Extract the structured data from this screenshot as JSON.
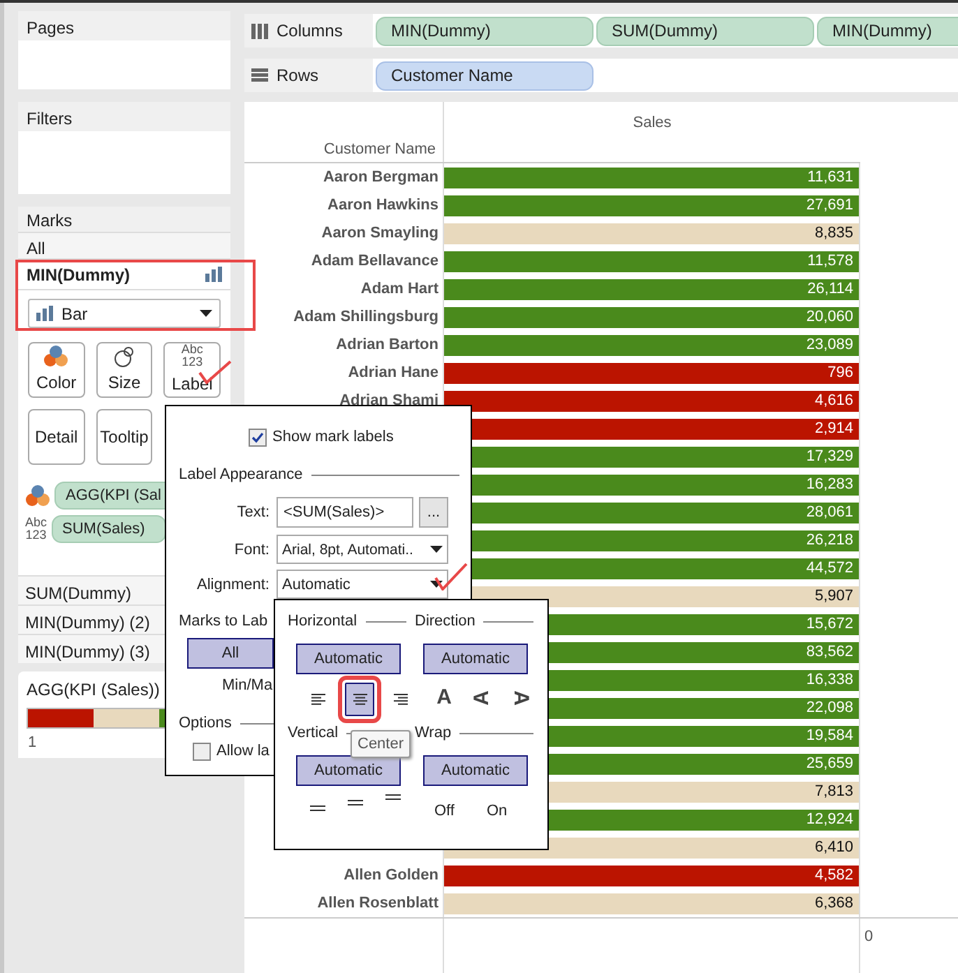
{
  "cards": {
    "pages": "Pages",
    "filters": "Filters"
  },
  "shelves": {
    "columns": {
      "label": "Columns",
      "pills": [
        "MIN(Dummy)",
        "SUM(Dummy)",
        "MIN(Dummy)"
      ]
    },
    "rows": {
      "label": "Rows",
      "pills": [
        "Customer Name"
      ]
    }
  },
  "marks": {
    "title": "Marks",
    "all": "All",
    "selected_layer": "MIN(Dummy)",
    "mark_type": "Bar",
    "buttons": [
      {
        "label": "Color",
        "kind": "color"
      },
      {
        "label": "Size",
        "kind": "size"
      },
      {
        "label": "Label",
        "kind": "label",
        "icon_text": [
          "Abc",
          "123"
        ]
      },
      {
        "label": "Detail",
        "kind": "detail"
      },
      {
        "label": "Tooltip",
        "kind": "tooltip"
      }
    ],
    "fields": [
      {
        "label": "AGG(KPI (Sal",
        "kind": "color"
      },
      {
        "label": "SUM(Sales)",
        "kind": "label",
        "icon_text": [
          "Abc",
          "123"
        ]
      }
    ],
    "layers": [
      "SUM(Dummy)",
      "MIN(Dummy) (2)",
      "MIN(Dummy) (3)"
    ]
  },
  "legend": {
    "title": "AGG(KPI (Sales))",
    "segments": [
      {
        "color": "#bb1400"
      },
      {
        "color": "#e8d9bd"
      },
      {
        "color": "#4a8a1c"
      }
    ],
    "tick": "1"
  },
  "chart": {
    "header": "Sales",
    "row_header": "Customer Name",
    "axis_tick": "0",
    "rows": [
      {
        "name": "Aaron Bergman",
        "value": "11,631",
        "color": "#4a8a1c"
      },
      {
        "name": "Aaron Hawkins",
        "value": "27,691",
        "color": "#4a8a1c"
      },
      {
        "name": "Aaron Smayling",
        "value": "8,835",
        "color": "#e8d9bd"
      },
      {
        "name": "Adam Bellavance",
        "value": "11,578",
        "color": "#4a8a1c"
      },
      {
        "name": "Adam Hart",
        "value": "26,114",
        "color": "#4a8a1c"
      },
      {
        "name": "Adam Shillingsburg",
        "value": "20,060",
        "color": "#4a8a1c"
      },
      {
        "name": "Adrian Barton",
        "value": "23,089",
        "color": "#4a8a1c"
      },
      {
        "name": "Adrian Hane",
        "value": "796",
        "color": "#bb1400"
      },
      {
        "name": "Adrian Shami",
        "value": "4,616",
        "color": "#bb1400"
      },
      {
        "value": "2,914",
        "color": "#bb1400"
      },
      {
        "value": "17,329",
        "color": "#4a8a1c"
      },
      {
        "value": "16,283",
        "color": "#4a8a1c"
      },
      {
        "value": "28,061",
        "color": "#4a8a1c"
      },
      {
        "value": "26,218",
        "color": "#4a8a1c"
      },
      {
        "value": "44,572",
        "color": "#4a8a1c"
      },
      {
        "value": "5,907",
        "color": "#e8d9bd"
      },
      {
        "value": "15,672",
        "color": "#4a8a1c"
      },
      {
        "value": "83,562",
        "color": "#4a8a1c"
      },
      {
        "value": "16,338",
        "color": "#4a8a1c"
      },
      {
        "value": "22,098",
        "color": "#4a8a1c"
      },
      {
        "value": "19,584",
        "color": "#4a8a1c"
      },
      {
        "value": "25,659",
        "color": "#4a8a1c"
      },
      {
        "value": "7,813",
        "color": "#e8d9bd"
      },
      {
        "value": "12,924",
        "color": "#4a8a1c"
      },
      {
        "value": "6,410",
        "color": "#e8d9bd"
      },
      {
        "name": "Allen Golden",
        "value": "4,582",
        "color": "#bb1400"
      },
      {
        "name": "Allen Rosenblatt",
        "value": "6,368",
        "color": "#e8d9bd"
      }
    ]
  },
  "label_dialog": {
    "show_labels": {
      "label": "Show mark labels",
      "checked": true
    },
    "section": "Label Appearance",
    "text_label": "Text:",
    "text_value": "<SUM(Sales)>",
    "more_button": "...",
    "font_label": "Font:",
    "font_value": "Arial, 8pt, Automati..",
    "alignment_label": "Alignment:",
    "alignment_value": "Automatic",
    "marks_to_label": "Marks to Lab",
    "marks_options": [
      {
        "label": "All",
        "selected": true
      }
    ],
    "min_max": "Min/Ma",
    "options": "Options",
    "allow_overlap": {
      "label": "Allow la",
      "checked": false
    }
  },
  "alignment_popup": {
    "horizontal": {
      "title": "Horizontal",
      "button": "Automatic",
      "options": [
        {
          "kind": "left",
          "selected": false
        },
        {
          "kind": "center",
          "selected": true
        },
        {
          "kind": "right",
          "selected": false
        }
      ]
    },
    "direction": {
      "title": "Direction",
      "button": "Automatic",
      "options": [
        {
          "kind": "upright",
          "glyph": "A",
          "selected": false
        },
        {
          "kind": "up",
          "glyph": "A",
          "selected": false
        },
        {
          "kind": "down",
          "glyph": "A",
          "selected": false
        }
      ]
    },
    "vertical": {
      "title": "Vertical",
      "button": "Automatic",
      "options": [
        {
          "kind": "bottom",
          "selected": false
        },
        {
          "kind": "middle",
          "selected": false
        },
        {
          "kind": "top",
          "selected": false
        }
      ]
    },
    "wrap": {
      "title": "Wrap",
      "button": "Automatic",
      "options": [
        {
          "label": "Off",
          "selected": false
        },
        {
          "label": "On",
          "selected": false
        }
      ]
    }
  },
  "tooltip": "Center"
}
